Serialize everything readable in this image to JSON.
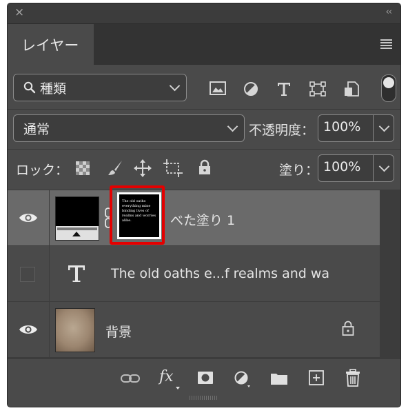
{
  "panel": {
    "close_label": "×",
    "collapse_label": "‹‹",
    "tab_title": "レイヤー"
  },
  "filter": {
    "kind_label": "種類",
    "icons": [
      "image-filter-icon",
      "adjustment-filter-icon",
      "type-filter-icon",
      "shape-filter-icon",
      "smart-object-filter-icon",
      "filter-toggle-icon"
    ]
  },
  "blend": {
    "mode": "通常",
    "opacity_label": "不透明度：",
    "opacity_value": "100%"
  },
  "lock": {
    "label": "ロック：",
    "icons": [
      "lock-transparent-pixels-icon",
      "lock-image-pixels-icon",
      "lock-position-icon",
      "lock-artboard-icon",
      "lock-all-icon"
    ],
    "fill_label": "塗り：",
    "fill_value": "100%"
  },
  "layers": [
    {
      "name": "べた塗り 1",
      "visible": true,
      "selected": true,
      "type": "fill",
      "mask_text": "The old oaths everything mine binding lives of realms and worries alike."
    },
    {
      "name": "The old oaths e...f realms and wa",
      "visible": false,
      "selected": false,
      "type": "text"
    },
    {
      "name": "背景",
      "visible": true,
      "selected": false,
      "type": "background",
      "locked": true
    }
  ],
  "footer": {
    "icons": [
      "link-layers-icon",
      "fx-icon",
      "add-mask-icon",
      "new-adjustment-icon",
      "new-group-icon",
      "new-layer-icon",
      "delete-layer-icon"
    ],
    "fx_label": "fx"
  }
}
